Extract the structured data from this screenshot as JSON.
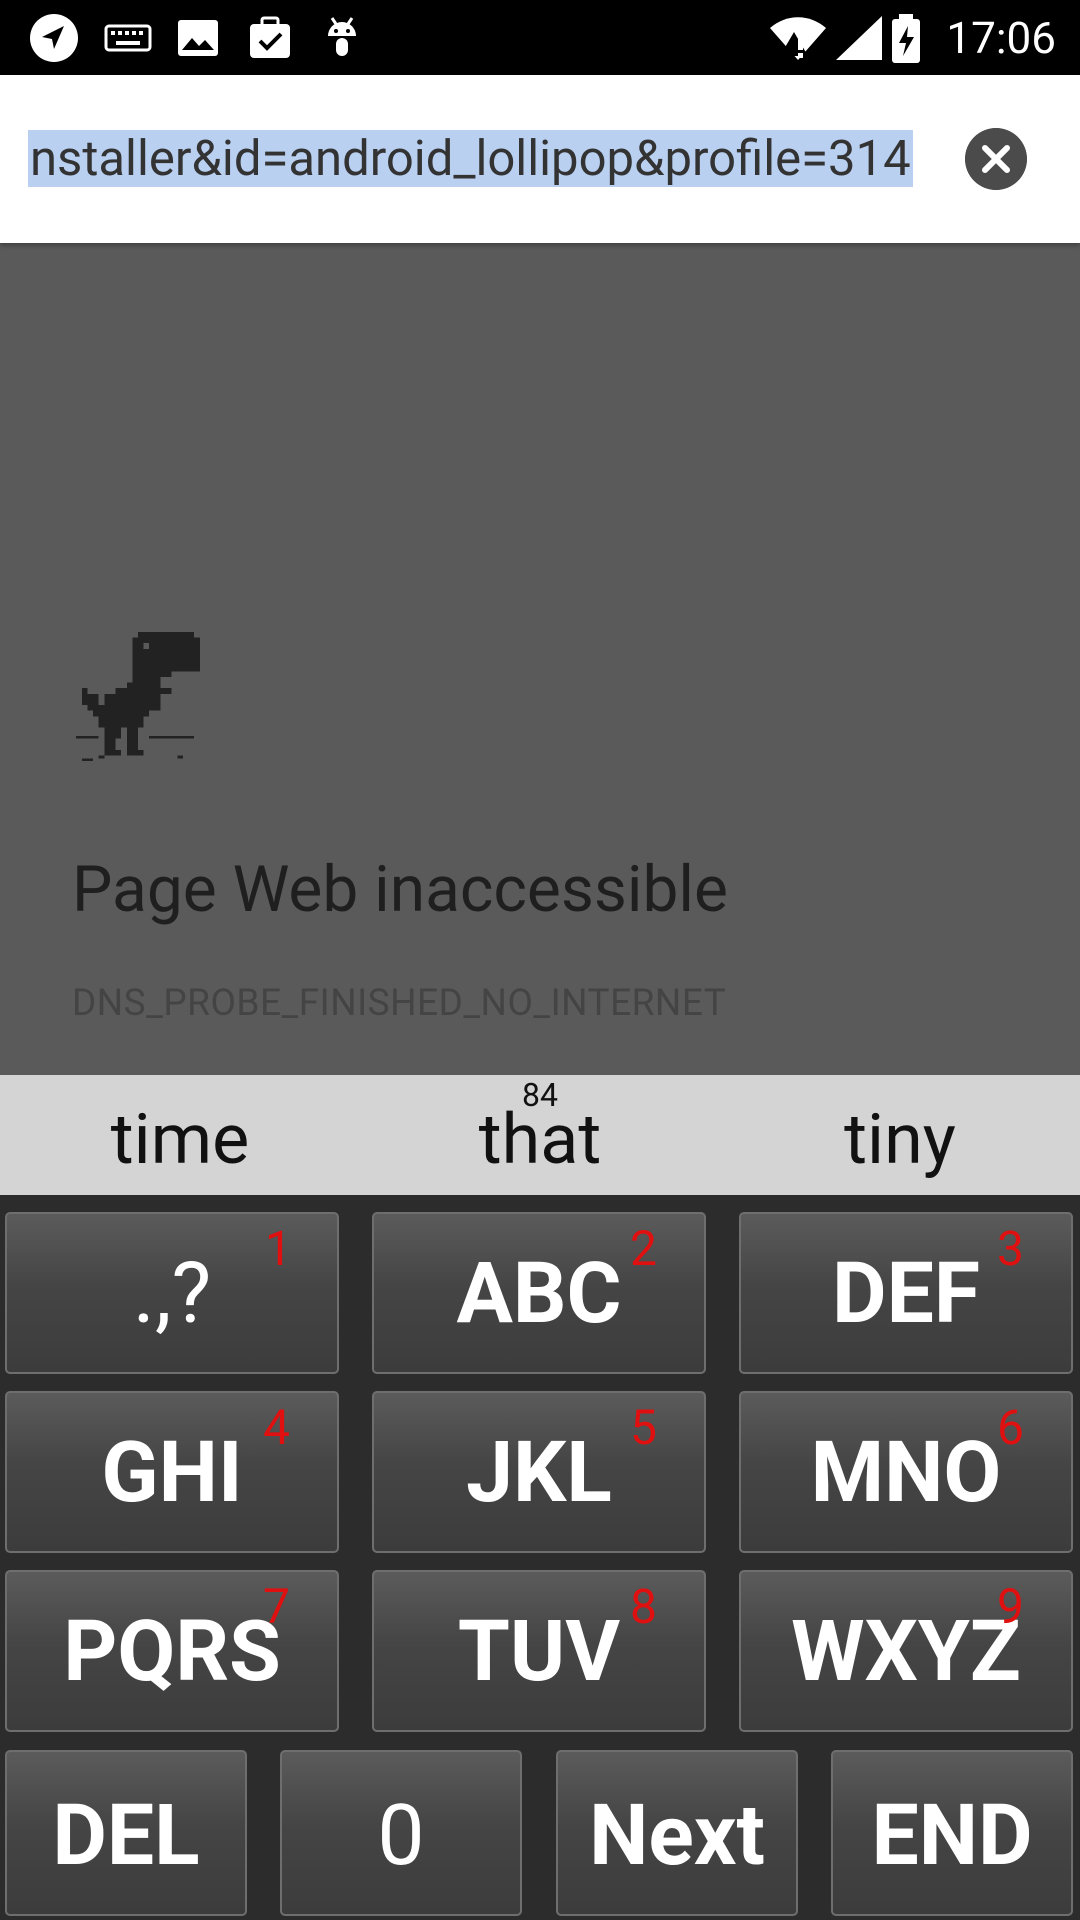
{
  "status_bar": {
    "time": "17:06",
    "left_icons": [
      "navigation-arrow-icon",
      "keyboard-icon",
      "image-icon",
      "clipboard-check-icon",
      "android-icon"
    ],
    "right_icons": [
      "wifi-alert-icon",
      "cell-signal-icon",
      "battery-charging-icon"
    ]
  },
  "url_bar": {
    "url_text": "nstaller&id=android_lollipop&profile=314",
    "clear_icon": "close-circle-icon"
  },
  "error_page": {
    "title": "Page Web inaccessible",
    "code": "DNS_PROBE_FINISHED_NO_INTERNET",
    "illustration": "dino-icon"
  },
  "suggestions": {
    "count": "84",
    "items": [
      "time",
      "that",
      "tiny"
    ]
  },
  "keypad": {
    "keys": [
      {
        "label": ".,?",
        "num": "1"
      },
      {
        "label": "ABC",
        "num": "2"
      },
      {
        "label": "DEF",
        "num": "3"
      },
      {
        "label": "GHI",
        "num": "4"
      },
      {
        "label": "JKL",
        "num": "5"
      },
      {
        "label": "MNO",
        "num": "6"
      },
      {
        "label": "PQRS",
        "num": "7"
      },
      {
        "label": "TUV",
        "num": "8"
      },
      {
        "label": "WXYZ",
        "num": "9"
      }
    ],
    "bottom": [
      "DEL",
      "0",
      "Next",
      "END"
    ]
  },
  "colors": {
    "status_bar_bg": "#000000",
    "page_bg": "#5a5a5a",
    "selection": "#b9d0f1",
    "key_number": "#e01010"
  }
}
